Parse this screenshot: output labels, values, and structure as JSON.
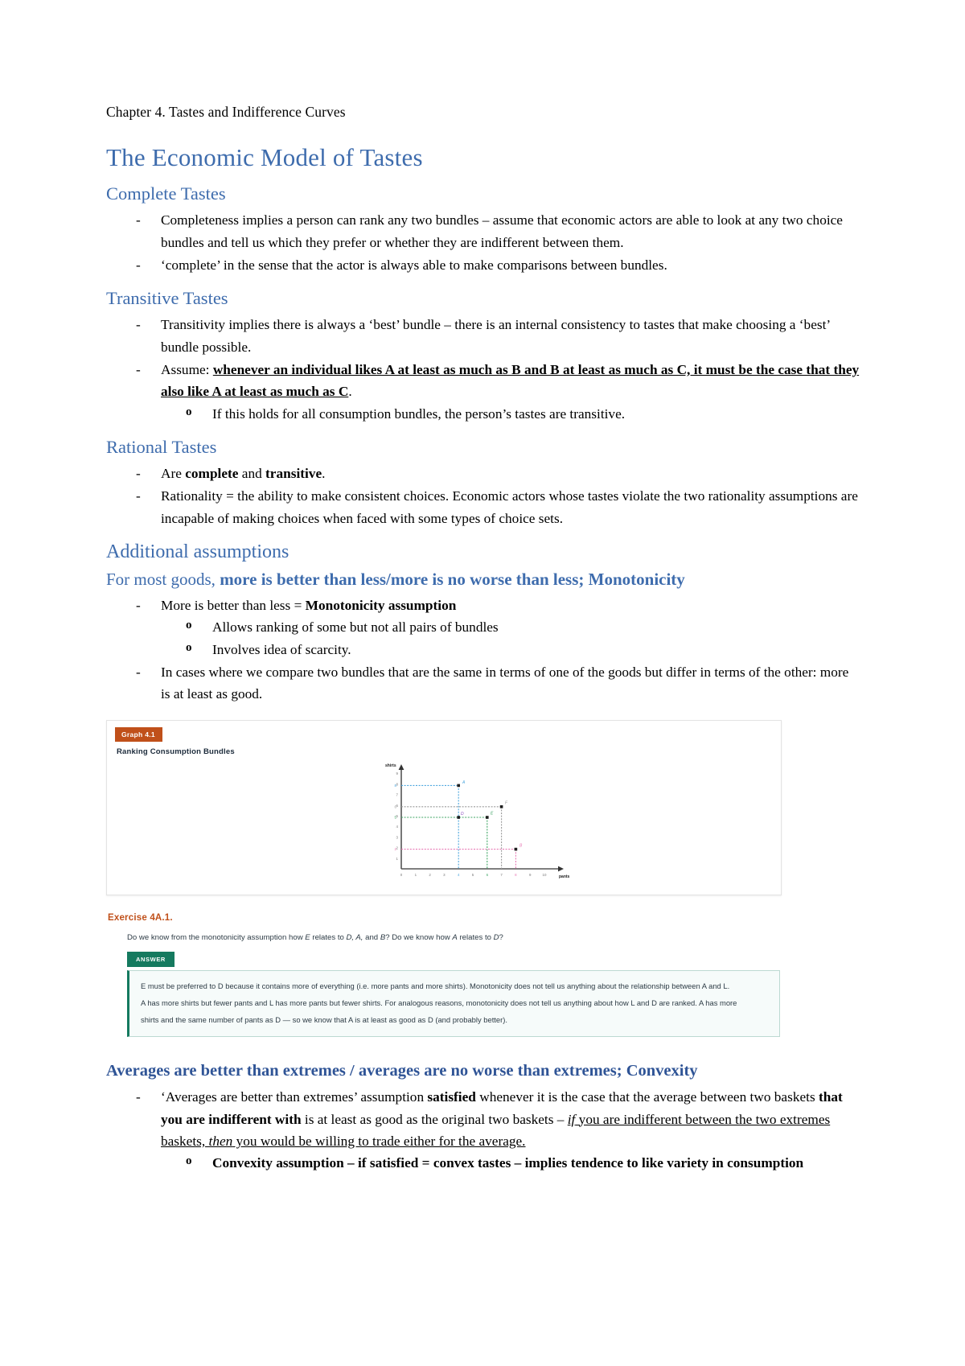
{
  "document": {
    "chapter_line": "Chapter 4. Tastes and Indifference Curves",
    "title": "The Economic Model of Tastes"
  },
  "sections": {
    "complete": {
      "heading": "Complete Tastes",
      "b1": "Completeness implies a person can rank any two bundles – assume that economic actors are able to look at any two choice bundles and tell us which they prefer or whether they are indifferent between them.",
      "b2": "‘complete’ in the sense that the actor is always able to make comparisons between bundles."
    },
    "transitive": {
      "heading": "Transitive Tastes",
      "b1": "Transitivity implies there is always a ‘best’ bundle – there is an internal consistency to tastes that make choosing a ‘best’ bundle possible.",
      "b2_lead": "Assume:",
      "b2_bold": "whenever an individual likes A at least as much as B and B at least as much as C, it must be the case that they also like A at least as much as C",
      "b2_tail": ".",
      "sub1": "If this holds for all consumption bundles, the person’s tastes are transitive."
    },
    "rational": {
      "heading": "Rational Tastes",
      "b1_a": "Are ",
      "b1_b1": "complete",
      "b1_mid": " and ",
      "b1_b2": "transitive",
      "b1_tail": ".",
      "b2": "Rationality = the ability to make consistent choices. Economic actors whose tastes violate the two rationality assumptions are incapable of making choices when faced with some types of choice sets."
    },
    "additional": {
      "heading": "Additional assumptions",
      "sub_lead": "For most goods, ",
      "sub_bold": "more is better than less/more is no worse than less; Monotonicity",
      "b1_lead": "More is better than less = ",
      "b1_bold": "Monotonicity assumption",
      "sub1": "Allows ranking of some but not all pairs of bundles",
      "sub2": "Involves idea of scarcity.",
      "b2": "In cases where we compare two bundles that are the same in terms of one of the goods but differ in terms of the other: more is at least as good."
    },
    "averages": {
      "heading": "Averages are better than extremes / averages are no worse than extremes; Convexity",
      "b1_p1": "‘Averages are better than extremes’ assumption ",
      "b1_b1": "satisfied",
      "b1_p2": " whenever it is the case that the average between two baskets ",
      "b1_b2": "that you are indifferent with",
      "b1_p3": " is at least as good as the original two baskets – ",
      "b1_u1": "if",
      "b1_u2": " you are indifferent between the two extremes baskets, ",
      "b1_u3": "then",
      "b1_u4": " you would be willing to trade either for the average. ",
      "sub1": "Convexity assumption – if satisfied = convex tastes – implies tendence to like variety in consumption"
    }
  },
  "figure": {
    "tag": "Graph 4.1",
    "caption": "Ranking Consumption Bundles"
  },
  "exercise": {
    "title": "Exercise  4A.1.",
    "question_p1": "Do we know from the monotonicity assumption how ",
    "question_e": "E",
    "question_p2": " relates to ",
    "question_dab": "D, A,",
    "question_p3": " and ",
    "question_b": "B",
    "question_p4": "? Do we know how ",
    "question_a": "A",
    "question_p5": " relates to ",
    "question_d": "D",
    "question_p6": "?",
    "answer_button": "ANSWER",
    "answer_l1": "E must be preferred to D because it contains more of everything (i.e. more pants and more shirts). Monotonicity does not tell us anything about the relationship between A and L.",
    "answer_l2": "A has more shirts but fewer pants and L has more pants but fewer shirts. For analogous reasons, monotonicity does not tell us anything about how L and D are ranked. A has more",
    "answer_l3": "shirts and the same number of pants as D — so we know that A is at least as good as D (and probably better)."
  },
  "chart_data": {
    "type": "scatter",
    "title": "Ranking Consumption Bundles",
    "xlabel": "pants",
    "ylabel": "shirts",
    "xlim": [
      0,
      10
    ],
    "ylim": [
      0,
      9
    ],
    "xticks": [
      "0",
      "1",
      "2",
      "3",
      "4",
      "5",
      "6",
      "7",
      "8",
      "9",
      "10"
    ],
    "yticks": [
      "1",
      "2",
      "3",
      "4",
      "5",
      "6",
      "7",
      "8",
      "9"
    ],
    "grid": false,
    "points": [
      {
        "label": "A",
        "x": 5,
        "y": 8,
        "color": "#4BA6DE"
      },
      {
        "label": "D",
        "x": 5,
        "y": 5,
        "color": "#8B4FBF"
      },
      {
        "label": "E",
        "x": 6,
        "y": 5,
        "color": "#3FA564"
      },
      {
        "label": "F",
        "x": 7,
        "y": 6,
        "color": "#7f7f7f"
      },
      {
        "label": "B",
        "x": 8,
        "y": 2,
        "color": "#E878B4"
      }
    ],
    "guides": [
      {
        "label": "A",
        "color": "#4BA6DE",
        "x": 5,
        "y": 8
      },
      {
        "label": "D",
        "color": "#3FA564",
        "x": 5,
        "y": 5
      },
      {
        "label": "F",
        "color": "#9a9a9a",
        "x": 7,
        "y": 6
      },
      {
        "label": "B",
        "color": "#E878B4",
        "x": 8,
        "y": 2
      }
    ]
  }
}
